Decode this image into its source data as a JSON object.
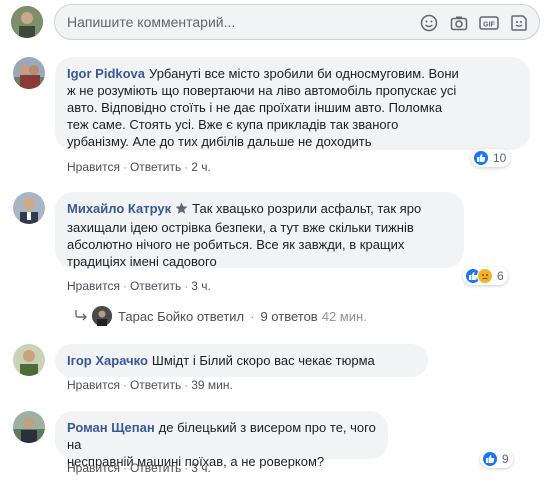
{
  "composer": {
    "placeholder": "Напишите комментарий...",
    "icons": [
      "emoji-icon",
      "camera-icon",
      "gif-icon",
      "sticker-icon"
    ]
  },
  "comments": [
    {
      "author": "Igor Pidkova",
      "lines": [
        "Урбануті все місто зробили би односмуговим. Вони",
        "ж не розуміють що повертаючи на ліво автомобіль пропускає усі",
        "авто. Відповідно стоїть і не дає проїхати іншим авто. Поломка",
        "теж саме. Стоять усі. Вже є купа прикладів так званого",
        "урбанізму. Але до тих дибілів дальше не доходить"
      ],
      "like": "Нравится",
      "reply": "Ответить",
      "time": "2 ч.",
      "reaction_count": "10"
    },
    {
      "author": "Михайло Катрук",
      "lines": [
        "Так хвацько розрили асфальт, так яро",
        "захищали ідею острівка безпеки, а тут вже скільки тижнів",
        "абсолютно нічого не робиться. Все як завжди, в кращих",
        "традиціях імені садового"
      ],
      "like": "Нравится",
      "reply": "Ответить",
      "time": "3 ч.",
      "reaction_count": "6",
      "replies": {
        "name": "Тарас Бойко ответил",
        "count": "9 ответов",
        "time": "42 мин."
      }
    },
    {
      "author": "Ігор Харачко",
      "lines": [
        "Шмідт і Білий скоро вас чекає тюрма"
      ],
      "like": "Нравится",
      "reply": "Ответить",
      "time": "39 мин."
    },
    {
      "author": "Роман Щепан",
      "lines": [
        "де білецький з висером про те, чого на",
        "несправній машині поїхав, а не роверком?"
      ],
      "like": "Нравится",
      "reply": "Ответить",
      "time": "3 ч.",
      "reaction_count": "9"
    }
  ],
  "colors": {
    "author": "#385898",
    "like": "#1877f2",
    "bubble": "#f2f3f5"
  }
}
